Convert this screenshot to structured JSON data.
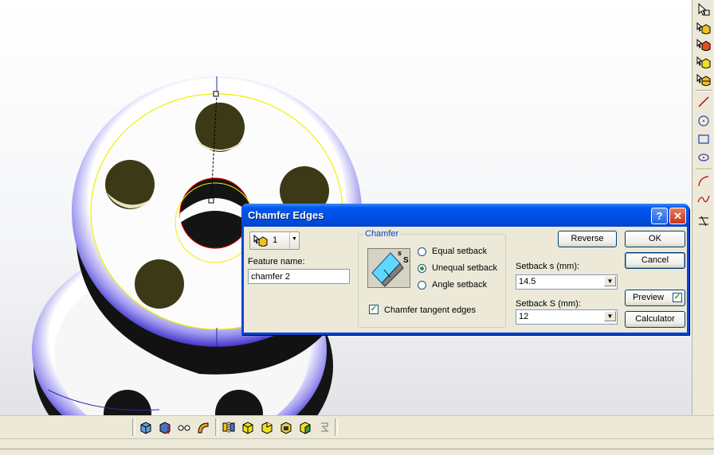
{
  "dialog": {
    "title": "Chamfer Edges",
    "help_glyph": "?",
    "close_glyph": "✕",
    "feature_selector_value": "1",
    "feature_name_label": "Feature name:",
    "feature_name_value": "chamfer 2",
    "chamfer_group_label": "Chamfer",
    "options": {
      "equal": "Equal setback",
      "unequal": "Unequal setback",
      "angle": "Angle setback",
      "selected": "unequal"
    },
    "tangent_label": "Chamfer tangent edges",
    "tangent_checked": true,
    "setback_small_label": "Setback s (mm):",
    "setback_small_value": "14.5",
    "setback_large_label": "Setback S (mm):",
    "setback_large_value": "12",
    "reverse_label": "Reverse",
    "ok_label": "OK",
    "cancel_label": "Cancel",
    "preview_label": "Preview",
    "preview_checked": true,
    "calculator_label": "Calculator",
    "diagram_small_s": "s",
    "diagram_large_s": "S"
  },
  "colors": {
    "titlebar": "#0054e3",
    "dialog_face": "#ece9d8",
    "part_rim": "#5b50e0",
    "hole_fill": "#3c3a16",
    "edge_yellow": "#f0f000",
    "edge_red": "#d00000"
  },
  "icons": {
    "right_toolbar": [
      "select-icon",
      "chamfer-cube-icon",
      "fillet-cube-icon",
      "shell-cube-icon",
      "blend-cube-icon",
      "line-icon",
      "circle-icon",
      "rectangle-icon",
      "ellipse-icon",
      "arc-icon",
      "spline-icon",
      "trim-icon"
    ],
    "bottom_toolbar": [
      "extrude-icon",
      "spin-icon",
      "pattern-icon",
      "sweep-icon",
      "mirror-icon",
      "cube-yellow-icon",
      "wedge-icon",
      "box-icon",
      "cylinder-icon",
      "disabled-icon"
    ]
  }
}
